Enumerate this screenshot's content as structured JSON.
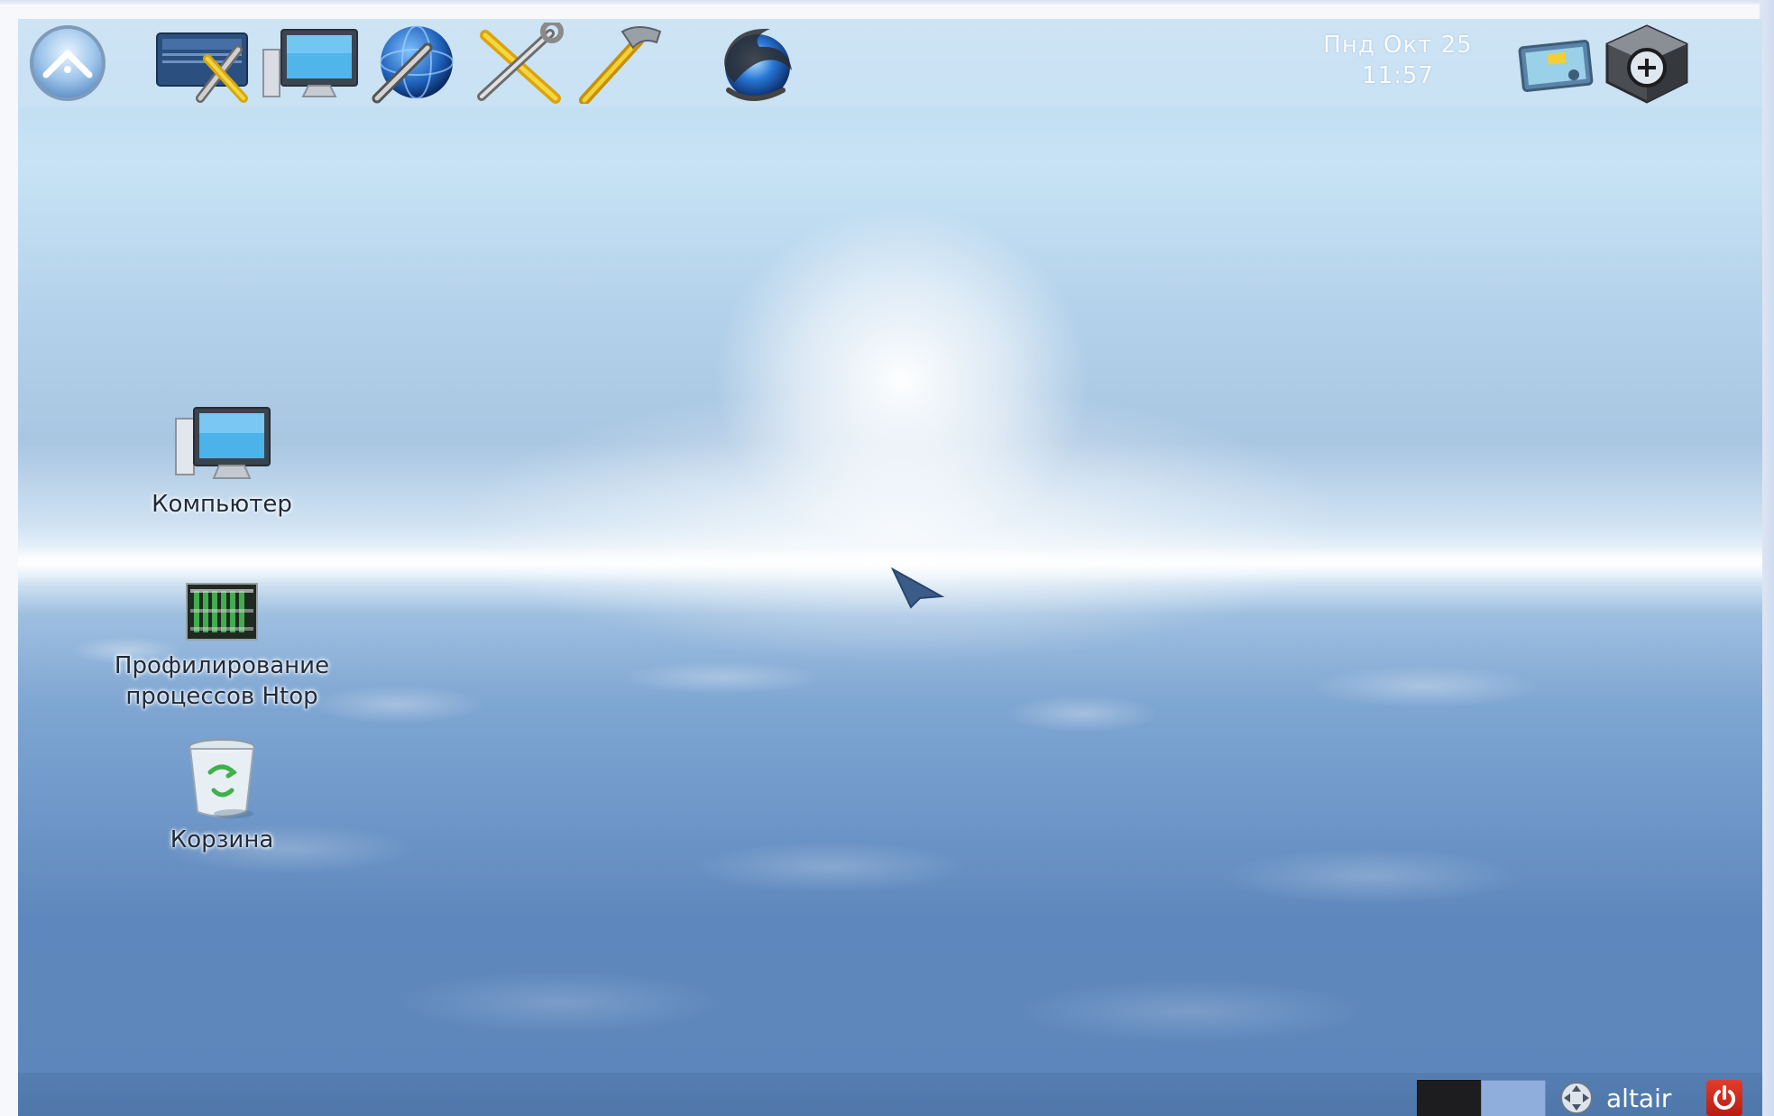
{
  "top_panel": {
    "launchers": [
      {
        "name": "main-menu-icon",
        "tooltip": ""
      },
      {
        "name": "control-center-icon"
      },
      {
        "name": "my-computer-icon"
      },
      {
        "name": "network-settings-icon"
      },
      {
        "name": "system-tools-icon"
      },
      {
        "name": "development-tools-icon"
      },
      {
        "name": "web-browser-icon"
      }
    ],
    "clock": {
      "date": "Пнд Окт 25",
      "time": "11:57"
    },
    "tray": [
      {
        "name": "desktop-switcher-icon"
      },
      {
        "name": "package-manager-icon"
      }
    ]
  },
  "desktop_icons": [
    {
      "name": "computer",
      "label": "Компьютер",
      "icon": "computer-icon"
    },
    {
      "name": "htop",
      "label_line1": "Профилирование",
      "label_line2": "процессов Htop",
      "icon": "htop-icon"
    },
    {
      "name": "trash",
      "label": "Корзина",
      "icon": "trash-icon"
    }
  ],
  "bottom_panel": {
    "workspaces": [
      "workspace-1",
      "workspace-2"
    ],
    "user": "altair"
  },
  "colors": {
    "power_button": "#d02a1d",
    "pager_active": "#1d1d1f",
    "pager_inactive": "#8faedc"
  }
}
